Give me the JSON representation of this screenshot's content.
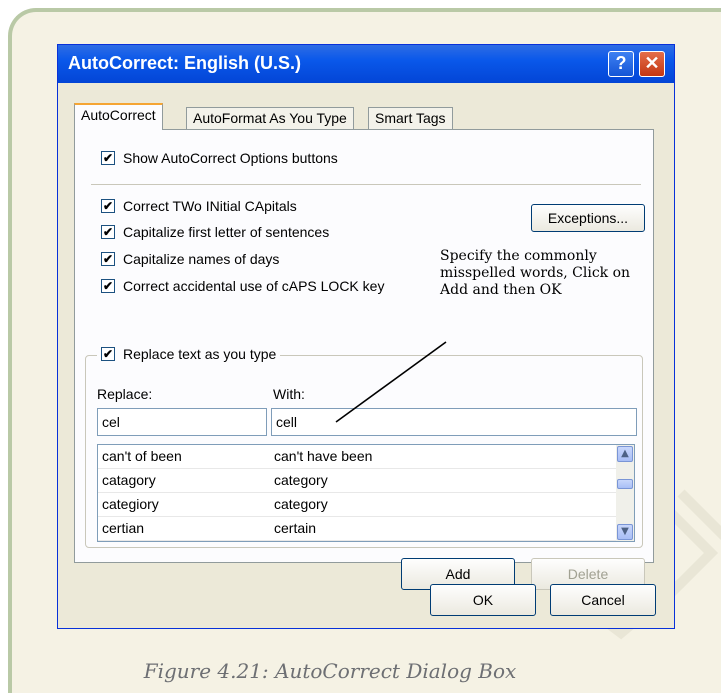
{
  "dialog": {
    "title": "AutoCorrect: English (U.S.)",
    "help_glyph": "?",
    "close_glyph": "✕",
    "tabs": [
      {
        "label": "AutoCorrect",
        "active": true
      },
      {
        "label": "AutoFormat As You Type",
        "active": false
      },
      {
        "label": "Smart Tags",
        "active": false
      }
    ]
  },
  "options": {
    "show_buttons": {
      "label": "Show AutoCorrect Options buttons",
      "checked": true
    },
    "correct_two_initials": {
      "label": "Correct TWo INitial CApitals",
      "checked": true
    },
    "capitalize_sentences": {
      "label": "Capitalize first letter of sentences",
      "checked": true
    },
    "capitalize_days": {
      "label": "Capitalize names of days",
      "checked": true
    },
    "caps_lock": {
      "label": "Correct accidental use of cAPS LOCK key",
      "checked": true
    },
    "replace_text": {
      "label": "Replace text as you type",
      "checked": true
    },
    "check_glyph": "✔"
  },
  "buttons": {
    "exceptions": "Exceptions...",
    "add": "Add",
    "delete": "Delete",
    "ok": "OK",
    "cancel": "Cancel"
  },
  "replace": {
    "replace_label": "Replace:",
    "with_label": "With:",
    "replace_value": "cel",
    "with_value": "cell",
    "rows": [
      {
        "from": "can't of been",
        "to": "can't have been"
      },
      {
        "from": "catagory",
        "to": "category"
      },
      {
        "from": "categiory",
        "to": "category"
      },
      {
        "from": "certian",
        "to": "certain"
      }
    ]
  },
  "annotation": "Specify the commonly misspelled words, Click on Add and then OK",
  "caption": "Figure 4.21: AutoCorrect Dialog Box",
  "colors": {
    "title_bar": "#0a58ea",
    "frame_border": "#b9c9a6",
    "frame_bg": "#f5f2e4"
  }
}
